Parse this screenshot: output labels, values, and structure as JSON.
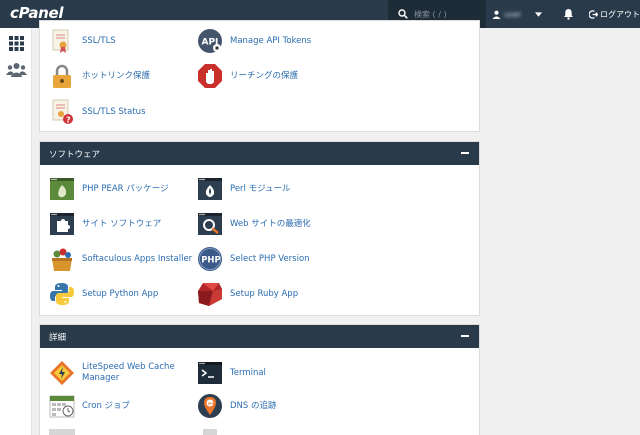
{
  "header": {
    "logo": "cPanel",
    "search_placeholder": "検索 ( / )",
    "user_name": "user",
    "logout_label": "ログアウト"
  },
  "panels": {
    "security": {
      "items": [
        {
          "label": "SSL/TLS",
          "icon": "ssl-certificate-icon"
        },
        {
          "label": "Manage API Tokens",
          "icon": "api-token-icon"
        },
        {
          "label": "ホットリンク保護",
          "icon": "hotlink-lock-icon"
        },
        {
          "label": "リーチングの保護",
          "icon": "leech-hand-icon"
        },
        {
          "label": "SSL/TLS Status",
          "icon": "ssl-status-icon"
        }
      ]
    },
    "software": {
      "title": "ソフトウェア",
      "items": [
        {
          "label": "PHP PEAR パッケージ",
          "icon": "pear-icon"
        },
        {
          "label": "Perl モジュール",
          "icon": "perl-onion-icon"
        },
        {
          "label": "サイト ソフトウェア",
          "icon": "puzzle-icon"
        },
        {
          "label": "Web サイトの最適化",
          "icon": "optimize-icon"
        },
        {
          "label": "Softaculous Apps Installer",
          "icon": "softaculous-icon"
        },
        {
          "label": "Select PHP Version",
          "icon": "php-icon"
        },
        {
          "label": "Setup Python App",
          "icon": "python-icon"
        },
        {
          "label": "Setup Ruby App",
          "icon": "ruby-icon"
        }
      ]
    },
    "advanced": {
      "title": "詳細",
      "items": [
        {
          "label": "LiteSpeed Web Cache Manager",
          "icon": "litespeed-icon"
        },
        {
          "label": "Terminal",
          "icon": "terminal-icon"
        },
        {
          "label": "Cron ジョブ",
          "icon": "cron-calendar-icon"
        },
        {
          "label": "DNS の追跡",
          "icon": "dns-pin-icon"
        }
      ]
    }
  },
  "colors": {
    "topbar": "#293a4a",
    "link": "#2b6cb0"
  }
}
